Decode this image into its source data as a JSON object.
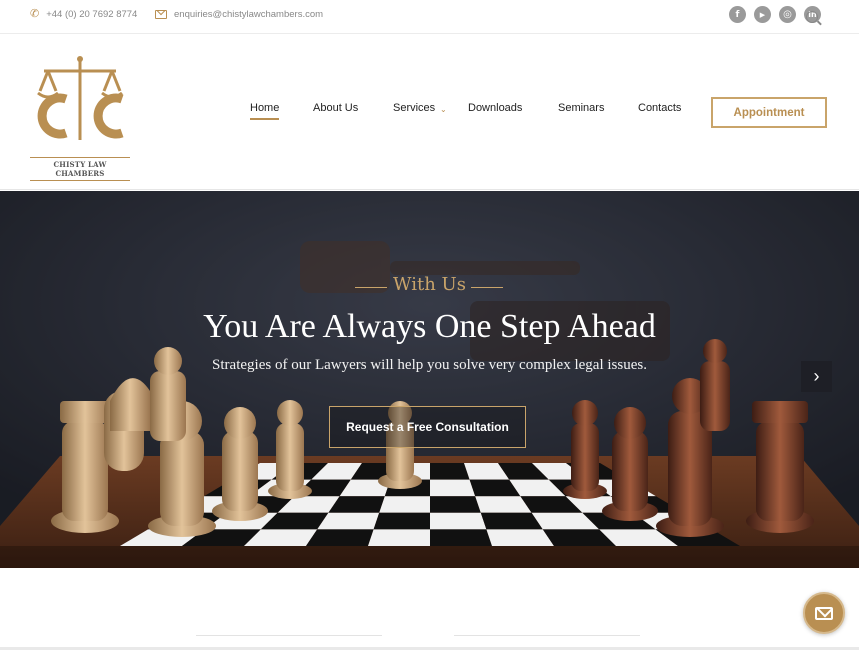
{
  "topbar": {
    "phone": "+44 (0) 20 7692 8774",
    "email": "enquiries@chistylawchambers.com",
    "socials": [
      {
        "icon": "facebook-icon",
        "glyph": "f"
      },
      {
        "icon": "youtube-icon",
        "glyph": "▶"
      },
      {
        "icon": "instagram-icon",
        "glyph": "◎"
      },
      {
        "icon": "linkedin-icon",
        "glyph": "in"
      }
    ]
  },
  "header": {
    "logo_text": "CHISTY LAW CHAMBERS",
    "nav": [
      {
        "label": "Home",
        "active": true
      },
      {
        "label": "About Us",
        "active": false
      },
      {
        "label": "Services",
        "active": false,
        "has_dropdown": true
      },
      {
        "label": "Downloads",
        "active": false
      },
      {
        "label": "Seminars",
        "active": false
      },
      {
        "label": "Contacts",
        "active": false
      }
    ],
    "appointment_label": "Appointment"
  },
  "hero": {
    "eyebrow": "With Us",
    "headline": "You Are Always One Step Ahead",
    "subtext": "Strategies of our Lawyers will help you solve very complex legal issues.",
    "cta_label": "Request a Free Consultation",
    "next_glyph": "›"
  },
  "colors": {
    "accent": "#b98f52",
    "hero_bg": "#2a2d36"
  }
}
